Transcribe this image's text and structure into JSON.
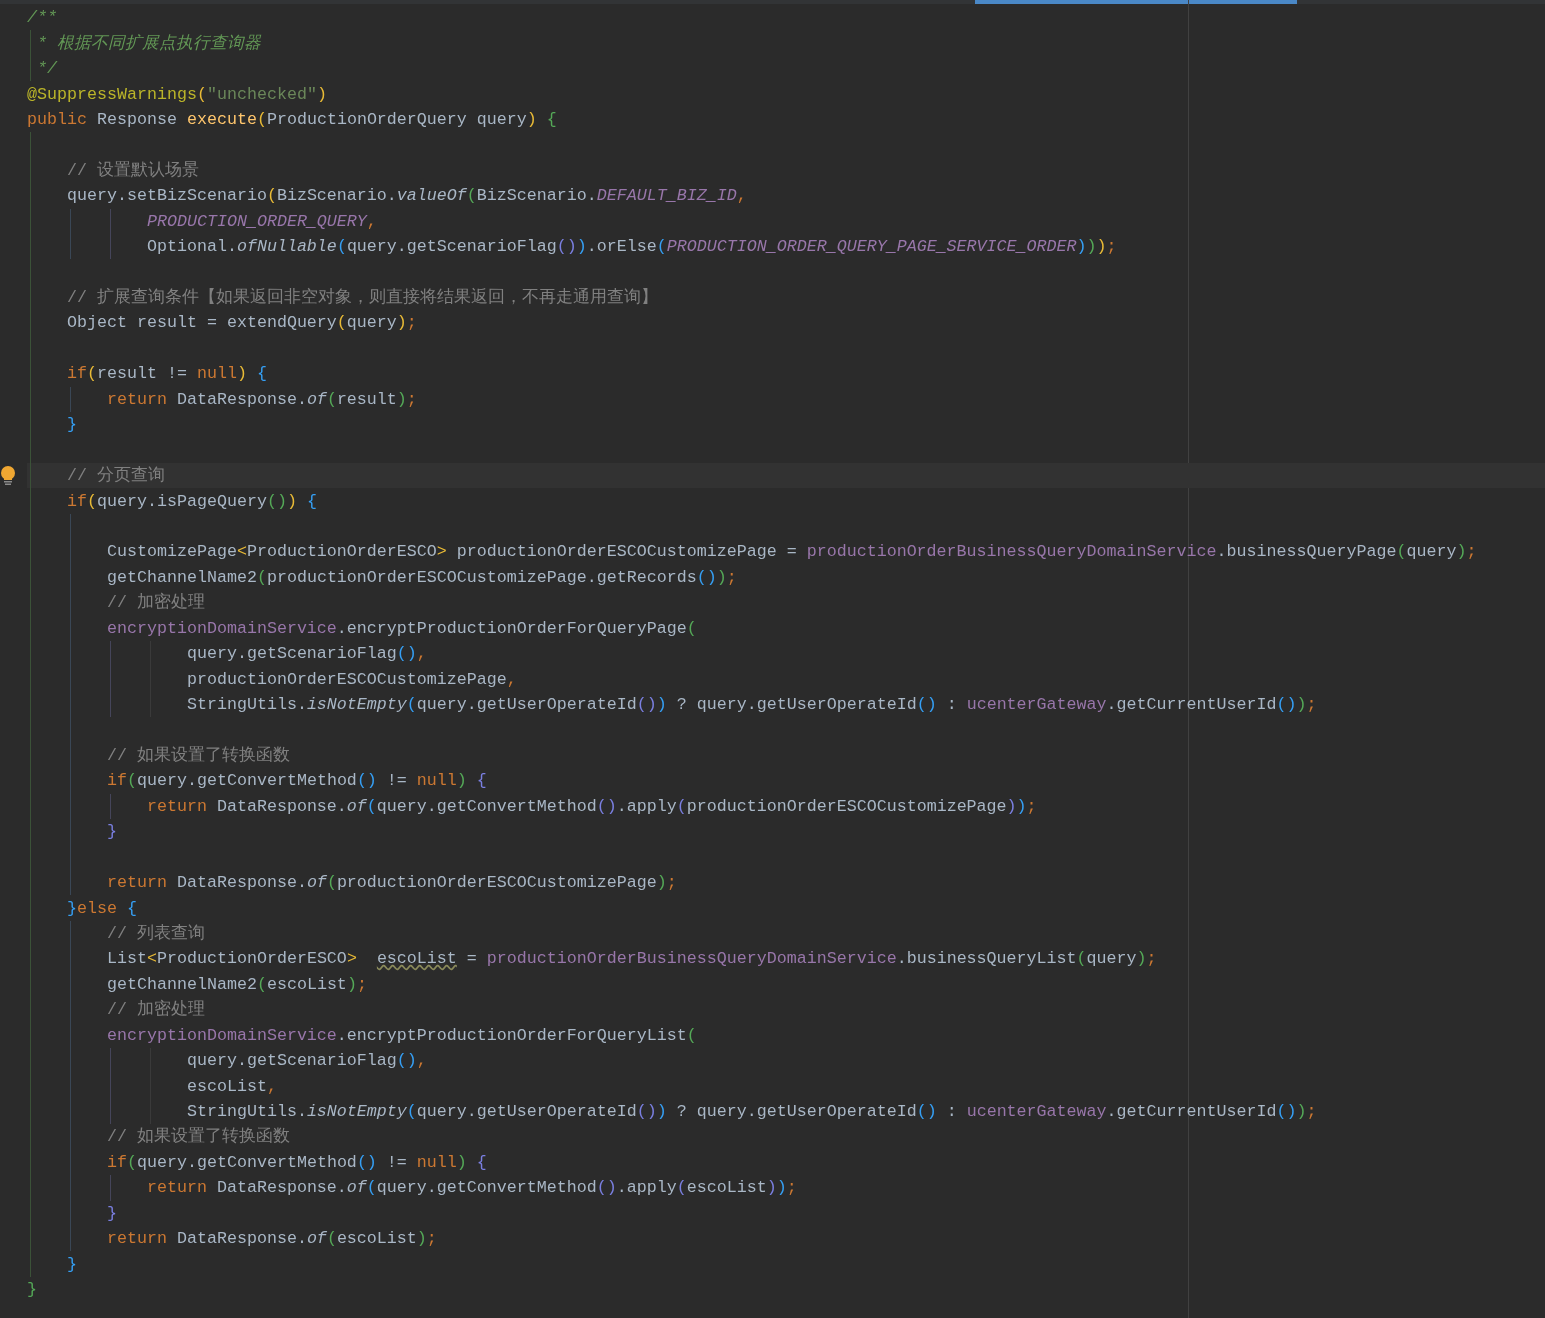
{
  "editor": {
    "lines": [
      {
        "current": false,
        "tokens": [
          {
            "text": "/**",
            "kind": "doc"
          }
        ]
      },
      {
        "current": false,
        "tokens": [
          {
            "text": " * 根据不同扩展点执行查询器",
            "kind": "doc"
          }
        ]
      },
      {
        "current": false,
        "tokens": [
          {
            "text": " */",
            "kind": "doc"
          }
        ]
      },
      {
        "current": false,
        "tokens": [
          {
            "text": "@SuppressWarnings",
            "kind": "anno"
          },
          {
            "text": "(",
            "kind": "bracket1"
          },
          {
            "text": "\"unchecked\"",
            "kind": "str"
          },
          {
            "text": ")",
            "kind": "bracket1"
          }
        ]
      },
      {
        "current": false,
        "tokens": [
          {
            "text": "public",
            "kind": "kw"
          },
          {
            "text": " Response ",
            "kind": "plain"
          },
          {
            "text": "execute",
            "kind": "decl"
          },
          {
            "text": "(",
            "kind": "bracket1"
          },
          {
            "text": "ProductionOrderQuery query",
            "kind": "plain"
          },
          {
            "text": ")",
            "kind": "bracket1"
          },
          {
            "text": " {",
            "kind": "bracket2"
          }
        ]
      },
      {
        "current": false
      },
      {
        "current": false,
        "tokens": [
          {
            "text": "    // 设置默认场景",
            "kind": "comment"
          }
        ]
      },
      {
        "current": false,
        "tokens": [
          {
            "text": "    query.setBizScenario",
            "kind": "plain"
          },
          {
            "text": "(",
            "kind": "bracket1"
          },
          {
            "text": "BizScenario.",
            "kind": "plain"
          },
          {
            "text": "valueOf",
            "kind": "static"
          },
          {
            "text": "(",
            "kind": "bracket2"
          },
          {
            "text": "BizScenario.",
            "kind": "plain"
          },
          {
            "text": "DEFAULT_BIZ_ID",
            "kind": "const"
          },
          {
            "text": ",",
            "kind": "punct"
          }
        ]
      },
      {
        "current": false,
        "tokens": [
          {
            "text": "            PRODUCTION_ORDER_QUERY",
            "kind": "const"
          },
          {
            "text": ",",
            "kind": "punct"
          }
        ]
      },
      {
        "current": false,
        "tokens": [
          {
            "text": "            Optional.",
            "kind": "plain"
          },
          {
            "text": "ofNullable",
            "kind": "static"
          },
          {
            "text": "(",
            "kind": "bracket3"
          },
          {
            "text": "query.getScenarioFlag",
            "kind": "plain"
          },
          {
            "text": "()",
            "kind": "bracket4"
          },
          {
            "text": ")",
            "kind": "bracket3"
          },
          {
            "text": ".orElse",
            "kind": "plain"
          },
          {
            "text": "(",
            "kind": "bracket3"
          },
          {
            "text": "PRODUCTION_ORDER_QUERY_PAGE_SERVICE_ORDER",
            "kind": "const"
          },
          {
            "text": ")",
            "kind": "bracket3"
          },
          {
            "text": ")",
            "kind": "bracket2"
          },
          {
            "text": ")",
            "kind": "bracket1"
          },
          {
            "text": ";",
            "kind": "punct"
          }
        ]
      },
      {
        "current": false
      },
      {
        "current": false,
        "tokens": [
          {
            "text": "    // 扩展查询条件【如果返回非空对象，则直接将结果返回，不再走通用查询】",
            "kind": "comment"
          }
        ]
      },
      {
        "current": false,
        "tokens": [
          {
            "text": "    Object result = extendQuery",
            "kind": "plain"
          },
          {
            "text": "(",
            "kind": "bracket1"
          },
          {
            "text": "query",
            "kind": "plain"
          },
          {
            "text": ")",
            "kind": "bracket1"
          },
          {
            "text": ";",
            "kind": "punct"
          }
        ]
      },
      {
        "current": false
      },
      {
        "current": false,
        "tokens": [
          {
            "text": "    if",
            "kind": "kw"
          },
          {
            "text": "(",
            "kind": "bracket1"
          },
          {
            "text": "result != ",
            "kind": "plain"
          },
          {
            "text": "null",
            "kind": "kw"
          },
          {
            "text": ")",
            "kind": "bracket1"
          },
          {
            "text": " {",
            "kind": "bracket3"
          }
        ]
      },
      {
        "current": false,
        "tokens": [
          {
            "text": "        return",
            "kind": "kw"
          },
          {
            "text": " DataResponse.",
            "kind": "plain"
          },
          {
            "text": "of",
            "kind": "static"
          },
          {
            "text": "(",
            "kind": "bracket2"
          },
          {
            "text": "result",
            "kind": "plain"
          },
          {
            "text": ")",
            "kind": "bracket2"
          },
          {
            "text": ";",
            "kind": "punct"
          }
        ]
      },
      {
        "current": false,
        "tokens": [
          {
            "text": "    }",
            "kind": "bracket3"
          }
        ]
      },
      {
        "current": false
      },
      {
        "current": true,
        "tokens": [
          {
            "text": "    // 分页查询",
            "kind": "comment"
          }
        ]
      },
      {
        "current": false,
        "tokens": [
          {
            "text": "    if",
            "kind": "kw"
          },
          {
            "text": "(",
            "kind": "bracket1"
          },
          {
            "text": "query.isPageQuery",
            "kind": "plain"
          },
          {
            "text": "()",
            "kind": "bracket2"
          },
          {
            "text": ")",
            "kind": "bracket1"
          },
          {
            "text": " {",
            "kind": "bracket3"
          }
        ]
      },
      {
        "current": false
      },
      {
        "current": false,
        "tokens": [
          {
            "text": "        CustomizePage",
            "kind": "plain"
          },
          {
            "text": "<",
            "kind": "bracket1"
          },
          {
            "text": "ProductionOrderESCO",
            "kind": "plain"
          },
          {
            "text": ">",
            "kind": "bracket1"
          },
          {
            "text": " productionOrderESCOCustomizePage = ",
            "kind": "plain"
          },
          {
            "text": "productionOrderBusinessQueryDomainService",
            "kind": "field"
          },
          {
            "text": ".businessQueryPage",
            "kind": "plain"
          },
          {
            "text": "(",
            "kind": "bracket2"
          },
          {
            "text": "query",
            "kind": "plain"
          },
          {
            "text": ")",
            "kind": "bracket2"
          },
          {
            "text": ";",
            "kind": "punct"
          }
        ]
      },
      {
        "current": false,
        "tokens": [
          {
            "text": "        getChannelName2",
            "kind": "plain"
          },
          {
            "text": "(",
            "kind": "bracket2"
          },
          {
            "text": "productionOrderESCOCustomizePage.getRecords",
            "kind": "plain"
          },
          {
            "text": "()",
            "kind": "bracket3"
          },
          {
            "text": ")",
            "kind": "bracket2"
          },
          {
            "text": ";",
            "kind": "punct"
          }
        ]
      },
      {
        "current": false,
        "tokens": [
          {
            "text": "        // 加密处理",
            "kind": "comment"
          }
        ]
      },
      {
        "current": false,
        "tokens": [
          {
            "text": "        encryptionDomainService",
            "kind": "field"
          },
          {
            "text": ".encryptProductionOrderForQueryPage",
            "kind": "plain"
          },
          {
            "text": "(",
            "kind": "bracket2"
          }
        ]
      },
      {
        "current": false,
        "tokens": [
          {
            "text": "                query.getScenarioFlag",
            "kind": "plain"
          },
          {
            "text": "()",
            "kind": "bracket3"
          },
          {
            "text": ",",
            "kind": "punct"
          }
        ]
      },
      {
        "current": false,
        "tokens": [
          {
            "text": "                productionOrderESCOCustomizePage",
            "kind": "plain"
          },
          {
            "text": ",",
            "kind": "punct"
          }
        ]
      },
      {
        "current": false,
        "tokens": [
          {
            "text": "                StringUtils.",
            "kind": "plain"
          },
          {
            "text": "isNotEmpty",
            "kind": "static"
          },
          {
            "text": "(",
            "kind": "bracket3"
          },
          {
            "text": "query.getUserOperateId",
            "kind": "plain"
          },
          {
            "text": "()",
            "kind": "bracket4"
          },
          {
            "text": ")",
            "kind": "bracket3"
          },
          {
            "text": " ? query.getUserOperateId",
            "kind": "plain"
          },
          {
            "text": "()",
            "kind": "bracket3"
          },
          {
            "text": " : ",
            "kind": "plain"
          },
          {
            "text": "ucenterGateway",
            "kind": "field"
          },
          {
            "text": ".getCurrentUserId",
            "kind": "plain"
          },
          {
            "text": "()",
            "kind": "bracket3"
          },
          {
            "text": ")",
            "kind": "bracket2"
          },
          {
            "text": ";",
            "kind": "punct"
          }
        ]
      },
      {
        "current": false
      },
      {
        "current": false,
        "tokens": [
          {
            "text": "        // 如果设置了转换函数",
            "kind": "comment"
          }
        ]
      },
      {
        "current": false,
        "tokens": [
          {
            "text": "        if",
            "kind": "kw"
          },
          {
            "text": "(",
            "kind": "bracket2"
          },
          {
            "text": "query.getConvertMethod",
            "kind": "plain"
          },
          {
            "text": "()",
            "kind": "bracket3"
          },
          {
            "text": " != ",
            "kind": "plain"
          },
          {
            "text": "null",
            "kind": "kw"
          },
          {
            "text": ")",
            "kind": "bracket2"
          },
          {
            "text": " {",
            "kind": "bracket4"
          }
        ]
      },
      {
        "current": false,
        "tokens": [
          {
            "text": "            return",
            "kind": "kw"
          },
          {
            "text": " DataResponse.",
            "kind": "plain"
          },
          {
            "text": "of",
            "kind": "static"
          },
          {
            "text": "(",
            "kind": "bracket3"
          },
          {
            "text": "query.getConvertMethod",
            "kind": "plain"
          },
          {
            "text": "()",
            "kind": "bracket4"
          },
          {
            "text": ".apply",
            "kind": "plain"
          },
          {
            "text": "(",
            "kind": "bracket4"
          },
          {
            "text": "productionOrderESCOCustomizePage",
            "kind": "plain"
          },
          {
            "text": ")",
            "kind": "bracket4"
          },
          {
            "text": ")",
            "kind": "bracket3"
          },
          {
            "text": ";",
            "kind": "punct"
          }
        ]
      },
      {
        "current": false,
        "tokens": [
          {
            "text": "        }",
            "kind": "bracket4"
          }
        ]
      },
      {
        "current": false
      },
      {
        "current": false,
        "tokens": [
          {
            "text": "        return",
            "kind": "kw"
          },
          {
            "text": " DataResponse.",
            "kind": "plain"
          },
          {
            "text": "of",
            "kind": "static"
          },
          {
            "text": "(",
            "kind": "bracket2"
          },
          {
            "text": "productionOrderESCOCustomizePage",
            "kind": "plain"
          },
          {
            "text": ")",
            "kind": "bracket2"
          },
          {
            "text": ";",
            "kind": "punct"
          }
        ]
      },
      {
        "current": false,
        "tokens": [
          {
            "text": "    }",
            "kind": "bracket3"
          },
          {
            "text": "else",
            "kind": "kw"
          },
          {
            "text": " {",
            "kind": "bracket3"
          }
        ]
      },
      {
        "current": false,
        "tokens": [
          {
            "text": "        // 列表查询",
            "kind": "comment"
          }
        ]
      },
      {
        "current": false,
        "tokens": [
          {
            "text": "        List",
            "kind": "plain"
          },
          {
            "text": "<",
            "kind": "bracket1"
          },
          {
            "text": "ProductionOrderESCO",
            "kind": "plain"
          },
          {
            "text": ">  ",
            "kind": "bracket1"
          },
          {
            "text": "escoList",
            "kind": "warn"
          },
          {
            "text": " = ",
            "kind": "plain"
          },
          {
            "text": "productionOrderBusinessQueryDomainService",
            "kind": "field"
          },
          {
            "text": ".businessQueryList",
            "kind": "plain"
          },
          {
            "text": "(",
            "kind": "bracket2"
          },
          {
            "text": "query",
            "kind": "plain"
          },
          {
            "text": ")",
            "kind": "bracket2"
          },
          {
            "text": ";",
            "kind": "punct"
          }
        ]
      },
      {
        "current": false,
        "tokens": [
          {
            "text": "        getChannelName2",
            "kind": "plain"
          },
          {
            "text": "(",
            "kind": "bracket2"
          },
          {
            "text": "escoList",
            "kind": "plain"
          },
          {
            "text": ")",
            "kind": "bracket2"
          },
          {
            "text": ";",
            "kind": "punct"
          }
        ]
      },
      {
        "current": false,
        "tokens": [
          {
            "text": "        // 加密处理",
            "kind": "comment"
          }
        ]
      },
      {
        "current": false,
        "tokens": [
          {
            "text": "        encryptionDomainService",
            "kind": "field"
          },
          {
            "text": ".encryptProductionOrderForQueryList",
            "kind": "plain"
          },
          {
            "text": "(",
            "kind": "bracket2"
          }
        ]
      },
      {
        "current": false,
        "tokens": [
          {
            "text": "                query.getScenarioFlag",
            "kind": "plain"
          },
          {
            "text": "()",
            "kind": "bracket3"
          },
          {
            "text": ",",
            "kind": "punct"
          }
        ]
      },
      {
        "current": false,
        "tokens": [
          {
            "text": "                escoList",
            "kind": "plain"
          },
          {
            "text": ",",
            "kind": "punct"
          }
        ]
      },
      {
        "current": false,
        "tokens": [
          {
            "text": "                StringUtils.",
            "kind": "plain"
          },
          {
            "text": "isNotEmpty",
            "kind": "static"
          },
          {
            "text": "(",
            "kind": "bracket3"
          },
          {
            "text": "query.getUserOperateId",
            "kind": "plain"
          },
          {
            "text": "()",
            "kind": "bracket4"
          },
          {
            "text": ")",
            "kind": "bracket3"
          },
          {
            "text": " ? query.getUserOperateId",
            "kind": "plain"
          },
          {
            "text": "()",
            "kind": "bracket3"
          },
          {
            "text": " : ",
            "kind": "plain"
          },
          {
            "text": "ucenterGateway",
            "kind": "field"
          },
          {
            "text": ".getCurrentUserId",
            "kind": "plain"
          },
          {
            "text": "()",
            "kind": "bracket3"
          },
          {
            "text": ")",
            "kind": "bracket2"
          },
          {
            "text": ";",
            "kind": "punct"
          }
        ]
      },
      {
        "current": false,
        "tokens": [
          {
            "text": "        // 如果设置了转换函数",
            "kind": "comment"
          }
        ]
      },
      {
        "current": false,
        "tokens": [
          {
            "text": "        if",
            "kind": "kw"
          },
          {
            "text": "(",
            "kind": "bracket2"
          },
          {
            "text": "query.getConvertMethod",
            "kind": "plain"
          },
          {
            "text": "()",
            "kind": "bracket3"
          },
          {
            "text": " != ",
            "kind": "plain"
          },
          {
            "text": "null",
            "kind": "kw"
          },
          {
            "text": ")",
            "kind": "bracket2"
          },
          {
            "text": " {",
            "kind": "bracket4"
          }
        ]
      },
      {
        "current": false,
        "tokens": [
          {
            "text": "            return",
            "kind": "kw"
          },
          {
            "text": " DataResponse.",
            "kind": "plain"
          },
          {
            "text": "of",
            "kind": "static"
          },
          {
            "text": "(",
            "kind": "bracket3"
          },
          {
            "text": "query.getConvertMethod",
            "kind": "plain"
          },
          {
            "text": "()",
            "kind": "bracket4"
          },
          {
            "text": ".apply",
            "kind": "plain"
          },
          {
            "text": "(",
            "kind": "bracket4"
          },
          {
            "text": "escoList",
            "kind": "plain"
          },
          {
            "text": ")",
            "kind": "bracket4"
          },
          {
            "text": ")",
            "kind": "bracket3"
          },
          {
            "text": ";",
            "kind": "punct"
          }
        ]
      },
      {
        "current": false,
        "tokens": [
          {
            "text": "        }",
            "kind": "bracket4"
          }
        ]
      },
      {
        "current": false,
        "tokens": [
          {
            "text": "        return",
            "kind": "kw"
          },
          {
            "text": " DataResponse.",
            "kind": "plain"
          },
          {
            "text": "of",
            "kind": "static"
          },
          {
            "text": "(",
            "kind": "bracket2"
          },
          {
            "text": "escoList",
            "kind": "plain"
          },
          {
            "text": ")",
            "kind": "bracket2"
          },
          {
            "text": ";",
            "kind": "punct"
          }
        ]
      },
      {
        "current": false,
        "tokens": [
          {
            "text": "    }",
            "kind": "bracket3"
          }
        ]
      },
      {
        "current": false,
        "tokens": [
          {
            "text": "}",
            "kind": "bracket2"
          }
        ]
      }
    ]
  }
}
